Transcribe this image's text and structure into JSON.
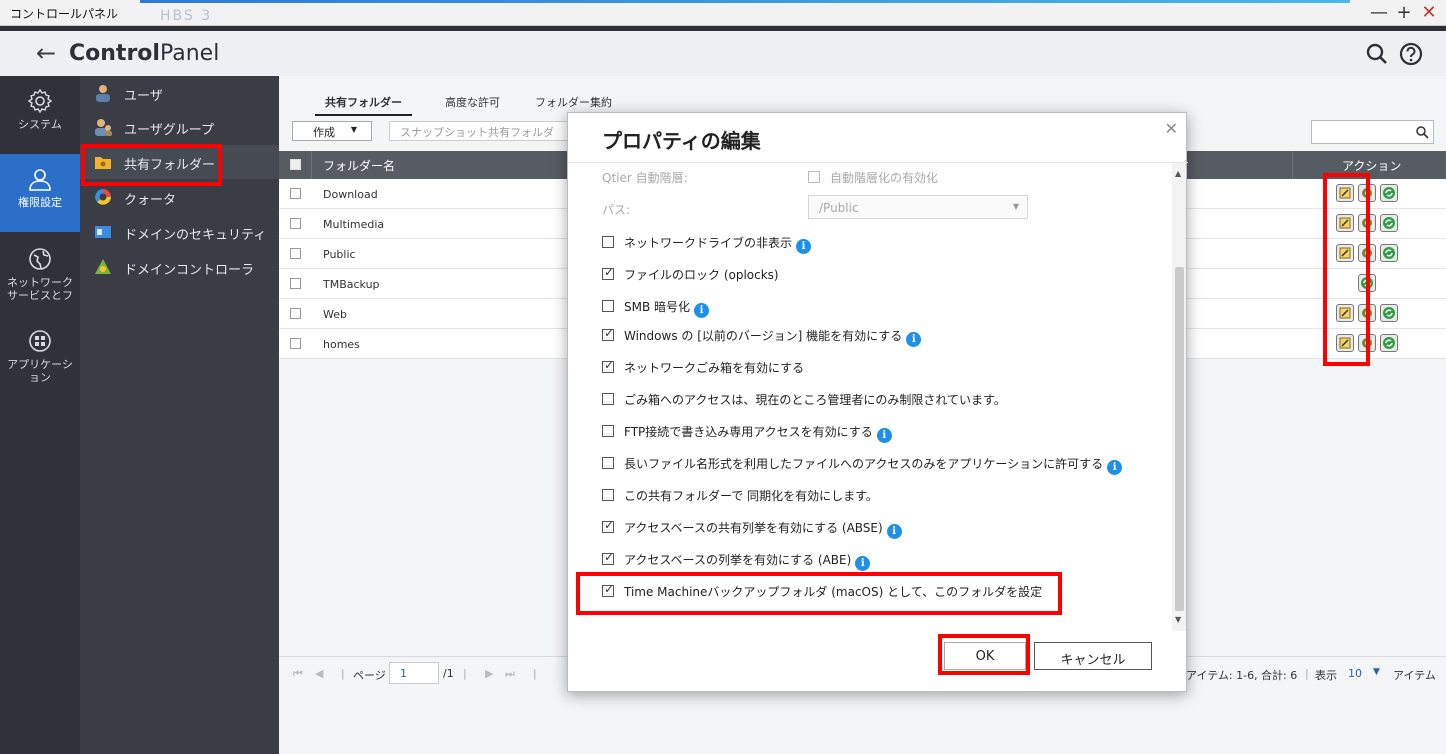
{
  "window": {
    "title": "コントロールパネル",
    "ghost_title": "HBS 3",
    "minimize": "—",
    "maximize": "+",
    "close": "✕"
  },
  "header": {
    "back_glyph": "←",
    "brand_bold": "Control",
    "brand_light": "Panel"
  },
  "leftnav": [
    {
      "label": "システム",
      "icon": "gear-icon"
    },
    {
      "label": "権限設定",
      "icon": "user-icon"
    },
    {
      "label": "ネットワーク サービスとフ",
      "icon": "globe-icon"
    },
    {
      "label": "アプリケーション",
      "icon": "apps-icon"
    }
  ],
  "submenu": [
    {
      "label": "ユーザ",
      "icon": "user-icon"
    },
    {
      "label": "ユーザグループ",
      "icon": "user-group-icon"
    },
    {
      "label": "共有フォルダー",
      "icon": "shared-folder-icon"
    },
    {
      "label": "クォータ",
      "icon": "quota-icon"
    },
    {
      "label": "ドメインのセキュリティ",
      "icon": "domain-security-icon"
    },
    {
      "label": "ドメインコントローラ",
      "icon": "domain-controller-icon"
    }
  ],
  "tabs": [
    "共有フォルダー",
    "高度な許可",
    "フォルダー集約"
  ],
  "toolbar": {
    "create_label": "作成",
    "snapshot_label": "スナップショット共有フォルダ"
  },
  "grid": {
    "col_name": "フォルダー名",
    "col_action": "アクション",
    "rows": [
      {
        "name": "Download"
      },
      {
        "name": "Multimedia"
      },
      {
        "name": "Public"
      },
      {
        "name": "TMBackup"
      },
      {
        "name": "Web"
      },
      {
        "name": "homes"
      }
    ]
  },
  "pager": {
    "first": "⏮",
    "prev": "◀",
    "page_label": "ページ",
    "page_value": "1",
    "total": "/1",
    "next": "▶",
    "last": "⏭",
    "items_summary": "アイテム: 1-6, 合計: 6",
    "show_label": "表示",
    "show_value": "10",
    "items_label": "アイテム"
  },
  "dialog": {
    "title": "プロパティの編集",
    "close": "✕",
    "qtier_label": "Qtier 自動階層:",
    "qtier_option": "自動階層化の有効化",
    "path_label": "パス:",
    "path_value": "/Public",
    "options": [
      {
        "text": "ネットワークドライブの非表示",
        "checked": false,
        "info": true
      },
      {
        "text": "ファイルのロック (oplocks)",
        "checked": true,
        "info": false
      },
      {
        "text": "SMB 暗号化",
        "checked": false,
        "info": true
      },
      {
        "text": "Windows の [以前のバージョン] 機能を有効にする",
        "checked": true,
        "info": true
      },
      {
        "text": "ネットワークごみ箱を有効にする",
        "checked": true,
        "info": false
      },
      {
        "text": "ごみ箱へのアクセスは、現在のところ管理者にのみ制限されています。",
        "checked": false,
        "info": false
      },
      {
        "text": "FTP接続で書き込み専用アクセスを有効にする",
        "checked": false,
        "info": true
      },
      {
        "text": "長いファイル名形式を利用したファイルへのアクセスのみをアプリケーションに許可する",
        "checked": false,
        "info": true
      },
      {
        "text": "この共有フォルダーで 同期化を有効にします。",
        "checked": false,
        "info": false
      },
      {
        "text": "アクセスベースの共有列挙を有効にする (ABSE)",
        "checked": true,
        "info": true
      },
      {
        "text": "アクセスベースの列挙を有効にする (ABE)",
        "checked": true,
        "info": true
      },
      {
        "text": "Time Machineバックアップフォルダ (macOS) として、このフォルダを設定",
        "checked": true,
        "info": false
      }
    ],
    "ok_label": "OK",
    "cancel_label": "キャンセル"
  },
  "colors": {
    "accent": "#2b6fc9",
    "nav_bg": "#2f323a",
    "submenu_bg": "#3a3d45",
    "grid_header": "#575b62",
    "info": "#1e90e8",
    "annotation": "#ff0000"
  }
}
